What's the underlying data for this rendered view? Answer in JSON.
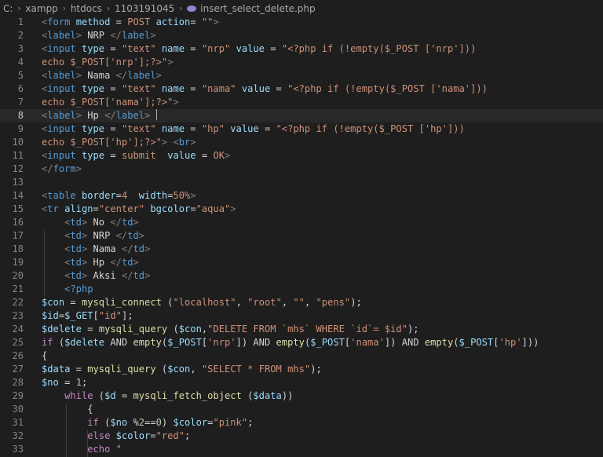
{
  "breadcrumb": {
    "items": [
      {
        "label": "C:"
      },
      {
        "label": "xampp"
      },
      {
        "label": "htdocs"
      },
      {
        "label": "1103191045"
      },
      {
        "label": "insert_select_delete.php",
        "icon": "php-file-icon"
      }
    ]
  },
  "editor": {
    "language": "php",
    "current_line": 8,
    "colors": {
      "background": "#1e1e1e",
      "line_number": "#858585",
      "tag": "#569cd6",
      "attribute": "#9cdcfe",
      "string": "#ce9178",
      "function": "#dcdcaa",
      "keyword": "#c586c0"
    },
    "lines": [
      {
        "n": "1",
        "tokens": [
          [
            "t",
            "<"
          ],
          [
            "tn",
            "form"
          ],
          [
            "p",
            " "
          ],
          [
            "at",
            "method"
          ],
          [
            "p",
            " = "
          ],
          [
            "s",
            "POST"
          ],
          [
            "p",
            " "
          ],
          [
            "at",
            "action"
          ],
          [
            "p",
            "= "
          ],
          [
            "s",
            "\"\""
          ],
          [
            "t",
            ">"
          ]
        ]
      },
      {
        "n": "2",
        "tokens": [
          [
            "t",
            "<"
          ],
          [
            "tn",
            "label"
          ],
          [
            "t",
            ">"
          ],
          [
            "p",
            " NRP "
          ],
          [
            "t",
            "</"
          ],
          [
            "tn",
            "label"
          ],
          [
            "t",
            ">"
          ]
        ]
      },
      {
        "n": "3",
        "tokens": [
          [
            "t",
            "<"
          ],
          [
            "tn",
            "input"
          ],
          [
            "p",
            " "
          ],
          [
            "at",
            "type"
          ],
          [
            "p",
            " = "
          ],
          [
            "s",
            "\"text\""
          ],
          [
            "p",
            " "
          ],
          [
            "at",
            "name"
          ],
          [
            "p",
            " = "
          ],
          [
            "s",
            "\"nrp\""
          ],
          [
            "p",
            " "
          ],
          [
            "at",
            "value"
          ],
          [
            "p",
            " = "
          ],
          [
            "s",
            "\"<?php if (!empty($_POST ['nrp']))"
          ]
        ]
      },
      {
        "n": "4",
        "tokens": [
          [
            "s",
            "echo $_POST['nrp'];?>\""
          ],
          [
            "t",
            ">"
          ]
        ]
      },
      {
        "n": "5",
        "tokens": [
          [
            "t",
            "<"
          ],
          [
            "tn",
            "label"
          ],
          [
            "t",
            ">"
          ],
          [
            "p",
            " Nama "
          ],
          [
            "t",
            "</"
          ],
          [
            "tn",
            "label"
          ],
          [
            "t",
            ">"
          ]
        ]
      },
      {
        "n": "6",
        "tokens": [
          [
            "t",
            "<"
          ],
          [
            "tn",
            "input"
          ],
          [
            "p",
            " "
          ],
          [
            "at",
            "type"
          ],
          [
            "p",
            " = "
          ],
          [
            "s",
            "\"text\""
          ],
          [
            "p",
            " "
          ],
          [
            "at",
            "name"
          ],
          [
            "p",
            " = "
          ],
          [
            "s",
            "\"nama\""
          ],
          [
            "p",
            " "
          ],
          [
            "at",
            "value"
          ],
          [
            "p",
            " = "
          ],
          [
            "s",
            "\"<?php if (!empty($_POST ['nama']))"
          ]
        ]
      },
      {
        "n": "7",
        "tokens": [
          [
            "s",
            "echo $_POST['nama'];?>\""
          ],
          [
            "t",
            ">"
          ]
        ]
      },
      {
        "n": "8",
        "tokens": [
          [
            "t",
            "<"
          ],
          [
            "tn",
            "label"
          ],
          [
            "t",
            ">"
          ],
          [
            "p",
            " Hp "
          ],
          [
            "t",
            "</"
          ],
          [
            "tn",
            "label"
          ],
          [
            "t",
            ">"
          ],
          [
            "p",
            " "
          ]
        ],
        "cursor": true
      },
      {
        "n": "9",
        "tokens": [
          [
            "t",
            "<"
          ],
          [
            "tn",
            "input"
          ],
          [
            "p",
            " "
          ],
          [
            "at",
            "type"
          ],
          [
            "p",
            " = "
          ],
          [
            "s",
            "\"text\""
          ],
          [
            "p",
            " "
          ],
          [
            "at",
            "name"
          ],
          [
            "p",
            " = "
          ],
          [
            "s",
            "\"hp\""
          ],
          [
            "p",
            " "
          ],
          [
            "at",
            "value"
          ],
          [
            "p",
            " = "
          ],
          [
            "s",
            "\"<?php if (!empty($_POST ['hp']))"
          ]
        ]
      },
      {
        "n": "10",
        "tokens": [
          [
            "s",
            "echo $_POST['hp'];?>\""
          ],
          [
            "t",
            ">"
          ],
          [
            "p",
            " "
          ],
          [
            "t",
            "<"
          ],
          [
            "tn",
            "br"
          ],
          [
            "t",
            ">"
          ]
        ]
      },
      {
        "n": "11",
        "tokens": [
          [
            "t",
            "<"
          ],
          [
            "tn",
            "input"
          ],
          [
            "p",
            " "
          ],
          [
            "at",
            "type"
          ],
          [
            "p",
            " = "
          ],
          [
            "s",
            "submit"
          ],
          [
            "p",
            "  "
          ],
          [
            "at",
            "value"
          ],
          [
            "p",
            " = "
          ],
          [
            "s",
            "OK"
          ],
          [
            "t",
            ">"
          ]
        ]
      },
      {
        "n": "12",
        "tokens": [
          [
            "t",
            "</"
          ],
          [
            "tn",
            "form"
          ],
          [
            "t",
            ">"
          ]
        ]
      },
      {
        "n": "13",
        "tokens": []
      },
      {
        "n": "14",
        "tokens": [
          [
            "t",
            "<"
          ],
          [
            "tn",
            "table"
          ],
          [
            "p",
            " "
          ],
          [
            "at",
            "border"
          ],
          [
            "p",
            "="
          ],
          [
            "s",
            "4"
          ],
          [
            "p",
            "  "
          ],
          [
            "at",
            "width"
          ],
          [
            "p",
            "="
          ],
          [
            "s",
            "50%"
          ],
          [
            "t",
            ">"
          ]
        ]
      },
      {
        "n": "15",
        "tokens": [
          [
            "t",
            "<"
          ],
          [
            "tn",
            "tr"
          ],
          [
            "p",
            " "
          ],
          [
            "at",
            "align"
          ],
          [
            "p",
            "="
          ],
          [
            "s",
            "\"center\""
          ],
          [
            "p",
            " "
          ],
          [
            "at",
            "bgcolor"
          ],
          [
            "p",
            "="
          ],
          [
            "s",
            "\"aqua\""
          ],
          [
            "t",
            ">"
          ]
        ]
      },
      {
        "n": "16",
        "tokens": [
          [
            "p",
            "    "
          ],
          [
            "t",
            "<"
          ],
          [
            "tn",
            "td"
          ],
          [
            "t",
            ">"
          ],
          [
            "p",
            " No "
          ],
          [
            "t",
            "</"
          ],
          [
            "tn",
            "td"
          ],
          [
            "t",
            ">"
          ]
        ]
      },
      {
        "n": "17",
        "tokens": [
          [
            "p",
            "    "
          ],
          [
            "t",
            "<"
          ],
          [
            "tn",
            "td"
          ],
          [
            "t",
            ">"
          ],
          [
            "p",
            " NRP "
          ],
          [
            "t",
            "</"
          ],
          [
            "tn",
            "td"
          ],
          [
            "t",
            ">"
          ]
        ]
      },
      {
        "n": "18",
        "tokens": [
          [
            "p",
            "    "
          ],
          [
            "t",
            "<"
          ],
          [
            "tn",
            "td"
          ],
          [
            "t",
            ">"
          ],
          [
            "p",
            " Nama "
          ],
          [
            "t",
            "</"
          ],
          [
            "tn",
            "td"
          ],
          [
            "t",
            ">"
          ]
        ]
      },
      {
        "n": "19",
        "tokens": [
          [
            "p",
            "    "
          ],
          [
            "t",
            "<"
          ],
          [
            "tn",
            "td"
          ],
          [
            "t",
            ">"
          ],
          [
            "p",
            " Hp "
          ],
          [
            "t",
            "</"
          ],
          [
            "tn",
            "td"
          ],
          [
            "t",
            ">"
          ]
        ]
      },
      {
        "n": "20",
        "tokens": [
          [
            "p",
            "    "
          ],
          [
            "t",
            "<"
          ],
          [
            "tn",
            "td"
          ],
          [
            "t",
            ">"
          ],
          [
            "p",
            " Aksi "
          ],
          [
            "t",
            "</"
          ],
          [
            "tn",
            "td"
          ],
          [
            "t",
            ">"
          ]
        ]
      },
      {
        "n": "21",
        "tokens": [
          [
            "p",
            "    "
          ],
          [
            "tn",
            "<?php"
          ]
        ]
      },
      {
        "n": "22",
        "tokens": [
          [
            "v",
            "$con"
          ],
          [
            "p",
            " = "
          ],
          [
            "f",
            "mysqli_connect"
          ],
          [
            "p",
            " ("
          ],
          [
            "s",
            "\"localhost\""
          ],
          [
            "p",
            ", "
          ],
          [
            "s",
            "\"root\""
          ],
          [
            "p",
            ", "
          ],
          [
            "s",
            "\"\""
          ],
          [
            "p",
            ", "
          ],
          [
            "s",
            "\"pens\""
          ],
          [
            "p",
            ");"
          ]
        ]
      },
      {
        "n": "23",
        "tokens": [
          [
            "v",
            "$id"
          ],
          [
            "p",
            "="
          ],
          [
            "v",
            "$_GET"
          ],
          [
            "p",
            "["
          ],
          [
            "s",
            "\"id\""
          ],
          [
            "p",
            "];"
          ]
        ]
      },
      {
        "n": "24",
        "tokens": [
          [
            "v",
            "$delete"
          ],
          [
            "p",
            " = "
          ],
          [
            "f",
            "mysqli_query"
          ],
          [
            "p",
            " ("
          ],
          [
            "v",
            "$con"
          ],
          [
            "p",
            ","
          ],
          [
            "s",
            "\"DELETE FROM `mhs` WHERE `id`= $id\""
          ],
          [
            "p",
            ");"
          ]
        ]
      },
      {
        "n": "25",
        "tokens": [
          [
            "k",
            "if"
          ],
          [
            "p",
            " ("
          ],
          [
            "v",
            "$delete"
          ],
          [
            "p",
            " AND "
          ],
          [
            "f",
            "empty"
          ],
          [
            "p",
            "("
          ],
          [
            "v",
            "$_POST"
          ],
          [
            "p",
            "["
          ],
          [
            "s",
            "'nrp'"
          ],
          [
            "p",
            "]) AND "
          ],
          [
            "f",
            "empty"
          ],
          [
            "p",
            "("
          ],
          [
            "v",
            "$_POST"
          ],
          [
            "p",
            "["
          ],
          [
            "s",
            "'nama'"
          ],
          [
            "p",
            "]) AND "
          ],
          [
            "f",
            "empty"
          ],
          [
            "p",
            "("
          ],
          [
            "v",
            "$_POST"
          ],
          [
            "p",
            "["
          ],
          [
            "s",
            "'hp'"
          ],
          [
            "p",
            "]))"
          ]
        ]
      },
      {
        "n": "26",
        "tokens": [
          [
            "p",
            "{"
          ]
        ]
      },
      {
        "n": "27",
        "tokens": [
          [
            "v",
            "$data"
          ],
          [
            "p",
            " = "
          ],
          [
            "f",
            "mysqli_query"
          ],
          [
            "p",
            " ("
          ],
          [
            "v",
            "$con"
          ],
          [
            "p",
            ", "
          ],
          [
            "s",
            "\"SELECT * FROM mhs\""
          ],
          [
            "p",
            ");"
          ]
        ]
      },
      {
        "n": "28",
        "tokens": [
          [
            "v",
            "$no"
          ],
          [
            "p",
            " = "
          ],
          [
            "n",
            "1"
          ],
          [
            "p",
            ";"
          ]
        ]
      },
      {
        "n": "29",
        "tokens": [
          [
            "p",
            "    "
          ],
          [
            "k",
            "while"
          ],
          [
            "p",
            " ("
          ],
          [
            "v",
            "$d"
          ],
          [
            "p",
            " = "
          ],
          [
            "f",
            "mysqli_fetch_object"
          ],
          [
            "p",
            " ("
          ],
          [
            "v",
            "$data"
          ],
          [
            "p",
            "))"
          ]
        ]
      },
      {
        "n": "30",
        "tokens": [
          [
            "p",
            "        {"
          ]
        ]
      },
      {
        "n": "31",
        "tokens": [
          [
            "p",
            "        "
          ],
          [
            "k",
            "if"
          ],
          [
            "p",
            " ("
          ],
          [
            "v",
            "$no"
          ],
          [
            "p",
            " %"
          ],
          [
            "n",
            "2"
          ],
          [
            "p",
            "=="
          ],
          [
            "n",
            "0"
          ],
          [
            "p",
            ") "
          ],
          [
            "v",
            "$color"
          ],
          [
            "p",
            "="
          ],
          [
            "s",
            "\"pink\""
          ],
          [
            "p",
            ";"
          ]
        ]
      },
      {
        "n": "32",
        "tokens": [
          [
            "p",
            "        "
          ],
          [
            "k",
            "else"
          ],
          [
            "p",
            " "
          ],
          [
            "v",
            "$color"
          ],
          [
            "p",
            "="
          ],
          [
            "s",
            "\"red\""
          ],
          [
            "p",
            ";"
          ]
        ]
      },
      {
        "n": "33",
        "tokens": [
          [
            "p",
            "        "
          ],
          [
            "k",
            "echo"
          ],
          [
            "p",
            " "
          ],
          [
            "s",
            "\""
          ]
        ]
      }
    ]
  }
}
